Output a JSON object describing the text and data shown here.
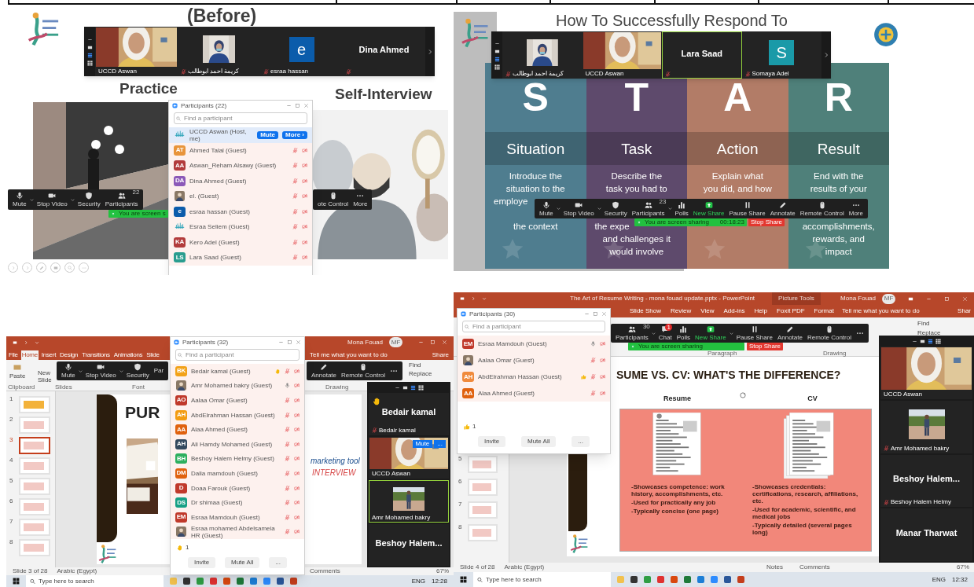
{
  "top_left": {
    "slide": {
      "title": "(Before)",
      "left_heading": "Practice",
      "right_heading": "Self-Interview"
    },
    "video_strip": [
      {
        "kind": "video",
        "name": "UCCD Aswan",
        "muted": false,
        "speaking": false
      },
      {
        "name": "كريمة احمد ابوطالب",
        "muted": true,
        "speaking": false
      },
      {
        "kind": "avatar",
        "initial": "e",
        "color": "#0b5cab",
        "name": "esraa hassan",
        "muted": true,
        "speaking": false
      },
      {
        "kind": "name",
        "title": "Dina Ahmed",
        "muted": true,
        "speaking": false
      }
    ],
    "toolbar": [
      {
        "kind": "mic",
        "label": "Mute",
        "caret": true
      },
      {
        "kind": "camera",
        "label": "Stop Video",
        "caret": true
      },
      {
        "kind": "shield",
        "label": "Security",
        "caret": false
      },
      {
        "kind": "people",
        "label": "Participants",
        "count": "22",
        "caret": false
      }
    ],
    "toolbar_right": [
      {
        "kind": "mouse",
        "label": "ote Control",
        "caret": false
      },
      {
        "kind": "dots",
        "label": "More",
        "caret": false
      }
    ],
    "sharing_banner": {
      "text": "You are screen s"
    },
    "participants": {
      "title": "Participants (22)",
      "search_placeholder": "Find a participant",
      "rows": [
        {
          "kind": "logo",
          "name": "UCCD Aswan (Host, me)",
          "highlighted": true,
          "buttons": [
            "Mute",
            "More ›"
          ]
        },
        {
          "kind": "initials",
          "initials": "AT",
          "color": "#e8943a",
          "name": "Ahmed Talal (Guest)",
          "highlighted": false,
          "muted": true
        },
        {
          "kind": "initials",
          "initials": "AA",
          "color": "#b23b3b",
          "name": "Aswan_Reham Alsawy (Guest)",
          "highlighted": false,
          "muted": true
        },
        {
          "kind": "initials",
          "initials": "DA",
          "color": "#8b59b8",
          "name": "Dina Ahmed (Guest)",
          "highlighted": false,
          "muted": true
        },
        {
          "name": "el. (Guest)",
          "highlighted": false,
          "muted": true
        },
        {
          "kind": "initials",
          "initials": "e",
          "color": "#0b5cab",
          "name": "esraa hassan (Guest)",
          "highlighted": false,
          "muted": true
        },
        {
          "kind": "logo",
          "name": "Esraa Seliem (Guest)",
          "highlighted": false,
          "muted": true
        },
        {
          "kind": "initials",
          "initials": "KA",
          "color": "#b23b3b",
          "name": "Kero Adel (Guest)",
          "highlighted": false,
          "muted": true
        },
        {
          "kind": "initials",
          "initials": "LS",
          "color": "#2a9d8f",
          "name": "Lara Saad (Guest)",
          "highlighted": false,
          "muted": true
        }
      ]
    }
  },
  "top_right": {
    "slide": {
      "title": "How To Successfully Respond To",
      "columns": [
        {
          "letter": "S",
          "word": "Situation",
          "color": "#4f7d8f",
          "lines_above": [
            {
              "text": "Introduce the",
              "cut": false
            },
            {
              "text": "situation to the",
              "cut": false
            },
            {
              "text": "employe",
              "cut": true
            }
          ],
          "lines_below": [
            {
              "text": "the context",
              "cut": false
            }
          ]
        },
        {
          "letter": "T",
          "word": "Task",
          "color": "#5e4a6c",
          "lines_above": [
            {
              "text": "Describe the",
              "cut": false
            },
            {
              "text": "task you had to",
              "cut": false
            }
          ],
          "lines_below": [
            {
              "text": "the expe",
              "cut": true
            },
            {
              "text": "and challenges it",
              "cut": false
            },
            {
              "text": "would involve",
              "cut": false
            }
          ]
        },
        {
          "letter": "A",
          "word": "Action",
          "color": "#b27c67",
          "lines_above": [
            {
              "text": "Explain what",
              "cut": false
            },
            {
              "text": "you did, and how",
              "cut": false
            }
          ]
        },
        {
          "letter": "R",
          "word": "Result",
          "color": "#4f807a",
          "lines_above": [
            {
              "text": "End with the",
              "cut": false
            },
            {
              "text": "results of your",
              "cut": false
            }
          ],
          "lines_below": [
            {
              "text": "accomplishments,",
              "cut": false
            },
            {
              "text": "rewards, and",
              "cut": false
            },
            {
              "text": "impact",
              "cut": false
            }
          ]
        }
      ]
    },
    "video_strip": [
      {
        "name": "كريمة احمد ابوطالب",
        "muted": true,
        "speaking": false
      },
      {
        "kind": "video",
        "name": "UCCD Aswan",
        "muted": false,
        "speaking": false
      },
      {
        "kind": "name",
        "title": "Lara Saad",
        "muted": true,
        "speaking": true
      },
      {
        "kind": "avatar",
        "initial": "S",
        "color": "#1a9aa8",
        "name": "Somaya Adel",
        "muted": true,
        "speaking": false
      }
    ],
    "toolbar": [
      {
        "kind": "mic",
        "label": "Mute",
        "caret": true
      },
      {
        "kind": "camera",
        "label": "Stop Video",
        "caret": true
      },
      {
        "kind": "shield",
        "label": "Security",
        "caret": false
      },
      {
        "kind": "people",
        "label": "Participants",
        "count": "23",
        "caret": true
      },
      {
        "kind": "chart",
        "label": "Polls",
        "caret": false
      },
      {
        "kind": "share",
        "label": "New Share",
        "caret": false
      },
      {
        "kind": "pause",
        "label": "Pause Share",
        "caret": false
      },
      {
        "kind": "pencil",
        "label": "Annotate",
        "caret": false
      },
      {
        "kind": "mouse",
        "label": "Remote Control",
        "caret": false
      },
      {
        "kind": "dots",
        "label": "More",
        "caret": false
      }
    ],
    "sharing_banner": {
      "text": "You are screen sharing",
      "time": "00:18:23",
      "stop": "Stop Share"
    }
  },
  "bottom_left": {
    "powerpoint": {
      "user": "Mona Fouad",
      "user_initials": "MF",
      "tabs": [
        {
          "label": "File",
          "selected": false
        },
        {
          "label": "Home",
          "selected": true
        },
        {
          "label": "Insert",
          "selected": false
        },
        {
          "label": "Design",
          "selected": false
        },
        {
          "label": "Transitions",
          "selected": false
        },
        {
          "label": "Animations",
          "selected": false
        },
        {
          "label": "Slide",
          "selected": false
        }
      ],
      "tell_me": "Tell me what you want to do",
      "share": "Share",
      "ribbon": {
        "paste": "Paste",
        "new_slide": "New Slide",
        "groups": [
          "Clipboard",
          "Slides",
          "Font",
          "Drawing"
        ],
        "find": "Find",
        "replace": "Replace"
      },
      "thumbnails": [
        {
          "number": "1",
          "selected": false
        },
        {
          "number": "2",
          "selected": false
        },
        {
          "number": "3",
          "selected": true
        },
        {
          "number": "4",
          "selected": false
        },
        {
          "number": "5",
          "selected": false
        },
        {
          "number": "6",
          "selected": false
        },
        {
          "number": "7",
          "selected": false
        },
        {
          "number": "8",
          "selected": false
        }
      ],
      "slide": {
        "title": "PUR",
        "line1": "marketing tool",
        "line2": "INTERVIEW"
      },
      "status": {
        "slide": "Slide 3 of 28",
        "language": "Arabic (Egypt)",
        "comments": "Comments",
        "zoom": "67%"
      }
    },
    "toolbar": [
      {
        "kind": "mic",
        "label": "Mute",
        "caret": true
      },
      {
        "kind": "camera",
        "label": "Stop Video",
        "caret": true
      },
      {
        "kind": "shield",
        "label": "Security",
        "caret": false
      },
      {
        "kind": "cut",
        "label": "Par",
        "caret": false
      }
    ],
    "toolbar_right": [
      {
        "kind": "pencil",
        "label": "Annotate",
        "caret": false
      },
      {
        "kind": "mouse",
        "label": "Remote Control",
        "caret": false
      },
      {
        "kind": "dots",
        "caret": false
      }
    ],
    "participants": {
      "title": "Participants (32)",
      "search_placeholder": "Find a participant",
      "rows": [
        {
          "kind": "initials",
          "initials": "BK",
          "color": "#f2a218",
          "name": "Bedair kamal (Guest)",
          "highlighted": false,
          "reaction": {
            "kind": "hand"
          },
          "muted": true
        },
        {
          "name": "Amr Mohamed bakry (Guest)",
          "highlighted": false,
          "muted": false
        },
        {
          "kind": "initials",
          "initials": "AO",
          "color": "#c0392b",
          "name": "Aalaa Omar (Guest)",
          "highlighted": false,
          "muted": true
        },
        {
          "kind": "initials",
          "initials": "AH",
          "color": "#f39c12",
          "name": "AbdElrahman Hassan (Guest)",
          "highlighted": false,
          "muted": true
        },
        {
          "kind": "initials",
          "initials": "AA",
          "color": "#e0620f",
          "name": "Alaa Ahmed (Guest)",
          "highlighted": false,
          "muted": true
        },
        {
          "kind": "initials",
          "initials": "AH",
          "color": "#34495e",
          "name": "Ali Hamdy  Mohamed (Guest)",
          "highlighted": false,
          "muted": true
        },
        {
          "kind": "initials",
          "initials": "BH",
          "color": "#2eaf5f",
          "name": "Beshoy Halem Helmy (Guest)",
          "highlighted": false,
          "muted": true
        },
        {
          "kind": "initials",
          "initials": "DM",
          "color": "#e0620f",
          "name": "Dalia mamdouh (Guest)",
          "highlighted": false,
          "muted": true
        },
        {
          "kind": "initials",
          "initials": "D",
          "color": "#c0392b",
          "name": "Doaa Farouk (Guest)",
          "highlighted": false,
          "muted": true
        },
        {
          "kind": "initials",
          "initials": "DS",
          "color": "#18a085",
          "name": "Dr shimaa (Guest)",
          "highlighted": false,
          "muted": true
        },
        {
          "kind": "initials",
          "initials": "EM",
          "color": "#c0392b",
          "name": "Esraa Mamdouh (Guest)",
          "highlighted": false,
          "muted": true
        },
        {
          "name": "Esraa mohamed Abdelsameia HR (Guest)",
          "highlighted": false,
          "muted": true
        }
      ],
      "footer": {
        "reaction": {
          "kind": "hand"
        },
        "count": "1",
        "buttons": [
          "Invite",
          "Mute All",
          "..."
        ]
      }
    },
    "video_panel": [
      {
        "kind": "name",
        "title": "Bedair kamal",
        "name": "Bedair kamal",
        "muted": true,
        "speaking": false,
        "reaction": {
          "kind": "hand"
        }
      },
      {
        "kind": "video",
        "name": "UCCD Aswan",
        "muted": false,
        "speaking": false,
        "buttons": [
          "Mute",
          "..."
        ]
      },
      {
        "name": "Amr Mohamed bakry",
        "muted": false,
        "speaking": true
      },
      {
        "kind": "name",
        "title": "Beshoy Halem...",
        "muted": false,
        "speaking": false
      }
    ],
    "taskbar": {
      "search_placeholder": "Type here to search",
      "language": "ENG",
      "time": "12:28"
    }
  },
  "bottom_right": {
    "powerpoint": {
      "title": "The Art of Resume Writing - mona fouad update.pptx - PowerPoint",
      "context": "Picture Tools",
      "user": "Mona Fouad",
      "user_initials": "MF",
      "tabs": [
        {
          "label": "Slide Show",
          "selected": false
        },
        {
          "label": "Review",
          "selected": false
        },
        {
          "label": "View",
          "selected": false
        },
        {
          "label": "Add-ins",
          "selected": false
        },
        {
          "label": "Help",
          "selected": false
        },
        {
          "label": "Foxit PDF",
          "selected": false
        },
        {
          "label": "Format",
          "selected": false
        }
      ],
      "tell_me": "Tell me what you want to do",
      "share": "Shar",
      "ribbon": {
        "find": "Find",
        "replace": "Replace",
        "groups": [
          "Paragraph",
          "Drawing"
        ]
      },
      "thumbnails": [
        {
          "number": "5",
          "selected": false
        },
        {
          "number": "6",
          "selected": false
        },
        {
          "number": "7",
          "selected": false
        },
        {
          "number": "8",
          "selected": false
        }
      ],
      "slide": {
        "title": "SUME VS. CV:  WHAT'S THE DIFFERENCE?",
        "panels": [
          {
            "heading": "Resume",
            "bullets": [
              "-Showcases competence: work history, accomplishments, etc.",
              "-Used for practically any job",
              "-Typically concise (one page)"
            ]
          },
          {
            "heading": "CV",
            "bullets": [
              "-Showcases credentials: certifications, research, affiliations, etc.",
              "-Used for academic, scientific, and medical jobs",
              "-Typically detailed (several pages long)"
            ]
          }
        ]
      },
      "status": {
        "slide": "Slide 4 of 28",
        "language": "Arabic (Egypt)",
        "notes": "Notes",
        "comments": "Comments",
        "zoom": "67%"
      }
    },
    "toolbar": [
      {
        "kind": "people",
        "label": "Participants",
        "count": "30",
        "caret": true
      },
      {
        "kind": "chat",
        "label": "Chat",
        "badge": "1",
        "caret": false
      },
      {
        "kind": "chart",
        "label": "Polls",
        "caret": false
      },
      {
        "kind": "share",
        "label": "New Share",
        "caret": true
      },
      {
        "kind": "pause",
        "label": "Pause Share",
        "caret": false
      },
      {
        "kind": "pencil",
        "label": "Annotate",
        "caret": false
      },
      {
        "kind": "mouse",
        "label": "Remote Control",
        "caret": false
      },
      {
        "kind": "dots",
        "caret": false
      }
    ],
    "sharing_banner": {
      "text": "You are screen sharing",
      "stop": "Stop Share"
    },
    "participants": {
      "title": "Participants (30)",
      "search_placeholder": "Find a participant",
      "rows": [
        {
          "kind": "initials",
          "initials": "EM",
          "color": "#c0392b",
          "name": "Esraa Mamdouh (Guest)",
          "highlighted": false,
          "muted": false
        },
        {
          "name": "Aalaa Omar (Guest)",
          "highlighted": false,
          "muted": true
        },
        {
          "kind": "initials",
          "initials": "AH",
          "color": "#f08a3c",
          "name": "AbdElrahman Hassan (Guest)",
          "highlighted": false,
          "reaction": {
            "kind": "thumbs"
          },
          "muted": true
        },
        {
          "kind": "initials",
          "initials": "AA",
          "color": "#e0620f",
          "name": "Alaa Ahmed (Guest)",
          "highlighted": false,
          "muted": true
        }
      ],
      "footer": {
        "reaction": {
          "kind": "thumbs"
        },
        "count": "1",
        "buttons": [
          "Invite",
          "Mute All",
          "..."
        ]
      }
    },
    "video_panel": [
      {
        "kind": "video",
        "name": "UCCD Aswan",
        "muted": false,
        "speaking": false
      },
      {
        "name": "Amr Mohamed bakry",
        "muted": true,
        "speaking": false
      },
      {
        "kind": "name",
        "title": "Beshoy  Halem...",
        "name": "Beshoy Halem Helmy",
        "muted": true,
        "speaking": false
      },
      {
        "kind": "name",
        "title": "Manar Tharwat",
        "muted": false,
        "speaking": false
      }
    ],
    "taskbar": {
      "search_placeholder": "Type here to search",
      "language": "ENG",
      "time": "12:32"
    }
  }
}
